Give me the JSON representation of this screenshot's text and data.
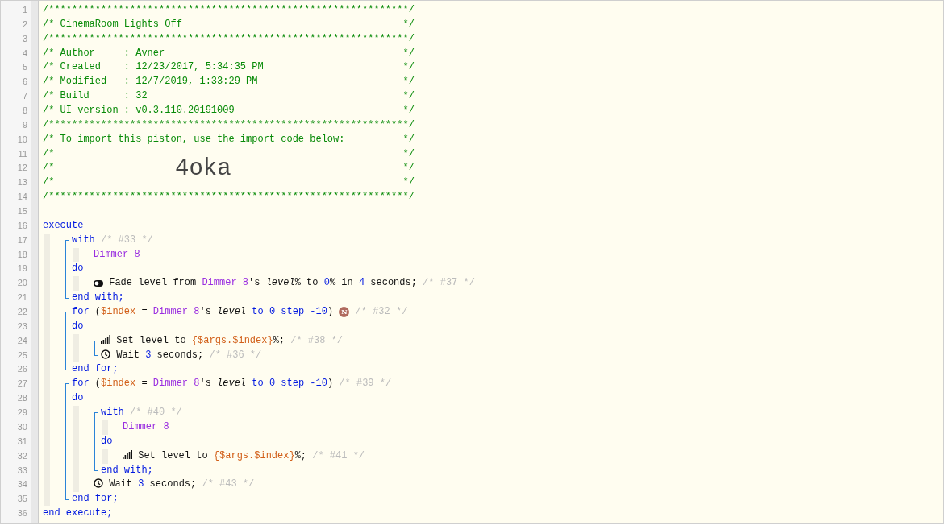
{
  "lines": [
    {
      "kind": "rule",
      "number": "1",
      "text": "/**************************************************************/"
    },
    {
      "kind": "box",
      "number": "2",
      "text": "/* CinemaRoom Lights Off",
      "end": "*/"
    },
    {
      "kind": "rule",
      "number": "3",
      "text": "/**************************************************************/"
    },
    {
      "kind": "box",
      "number": "4",
      "text": "/* Author     : Avner",
      "end": "*/"
    },
    {
      "kind": "box",
      "number": "5",
      "text": "/* Created    : 12/23/2017, 5:34:35 PM",
      "end": "*/"
    },
    {
      "kind": "box",
      "number": "6",
      "text": "/* Modified   : 12/7/2019, 1:33:29 PM",
      "end": "*/"
    },
    {
      "kind": "box",
      "number": "7",
      "text": "/* Build      : 32",
      "end": "*/"
    },
    {
      "kind": "box",
      "number": "8",
      "text": "/* UI version : v0.3.110.20191009",
      "end": "*/"
    },
    {
      "kind": "rule",
      "number": "9",
      "text": "/**************************************************************/"
    },
    {
      "kind": "box",
      "number": "10",
      "text": "/* To import this piston, use the import code below:",
      "end": "*/"
    },
    {
      "kind": "box",
      "number": "11",
      "text": "/*",
      "end": "*/"
    },
    {
      "kind": "code",
      "number": "12",
      "text": "/*",
      "code": "4oka",
      "end": "*/"
    },
    {
      "kind": "box",
      "number": "13",
      "text": "/*",
      "end": "*/"
    },
    {
      "kind": "rule",
      "number": "14",
      "text": "/**************************************************************/"
    },
    {
      "kind": "line",
      "number": "15"
    },
    {
      "kind": "line",
      "number": "16",
      "tokens": [
        {
          "kind": "kw",
          "text": "execute"
        }
      ]
    },
    {
      "kind": "body",
      "children": [
        {
          "kind": "block",
          "children": [
            {
              "kind": "line",
              "number": "17",
              "tokens": [
                {
                  "kind": "kw",
                  "text": "with"
                },
                {
                  "kind": "note",
                  "text": " /* #33 */"
                }
              ]
            },
            {
              "kind": "body",
              "children": [
                {
                  "kind": "line",
                  "number": "18",
                  "tokens": [
                    {
                      "kind": "device",
                      "text": "Dimmer 8"
                    }
                  ]
                }
              ]
            },
            {
              "kind": "line",
              "number": "19",
              "tokens": [
                {
                  "kind": "kw",
                  "text": "do"
                }
              ]
            },
            {
              "kind": "body",
              "children": [
                {
                  "kind": "line",
                  "number": "20",
                  "tokens": [
                    {
                      "kind": "toggle"
                    },
                    {
                      "kind": "plain",
                      "text": " Fade level from "
                    },
                    {
                      "kind": "device",
                      "text": "Dimmer 8"
                    },
                    {
                      "kind": "plain",
                      "text": "'s "
                    },
                    {
                      "kind": "italic",
                      "text": "level"
                    },
                    {
                      "kind": "plain",
                      "text": "% to "
                    },
                    {
                      "kind": "num",
                      "text": "0"
                    },
                    {
                      "kind": "plain",
                      "text": "% in "
                    },
                    {
                      "kind": "num",
                      "text": "4"
                    },
                    {
                      "kind": "plain",
                      "text": " seconds;"
                    },
                    {
                      "kind": "note",
                      "text": " /* #37 */"
                    }
                  ]
                }
              ]
            },
            {
              "kind": "line",
              "number": "21",
              "tokens": [
                {
                  "kind": "kw",
                  "text": "end with;"
                }
              ]
            }
          ]
        },
        {
          "kind": "block",
          "children": [
            {
              "kind": "line",
              "number": "22",
              "tokens": [
                {
                  "kind": "kw",
                  "text": "for"
                },
                {
                  "kind": "plain",
                  "text": " ("
                },
                {
                  "kind": "var",
                  "text": "$index"
                },
                {
                  "kind": "plain",
                  "text": " = "
                },
                {
                  "kind": "device",
                  "text": "Dimmer 8"
                },
                {
                  "kind": "plain",
                  "text": "'s "
                },
                {
                  "kind": "italic",
                  "text": "level"
                },
                {
                  "kind": "kw",
                  "text": " to "
                },
                {
                  "kind": "num",
                  "text": "0"
                },
                {
                  "kind": "kw",
                  "text": " step "
                },
                {
                  "kind": "num",
                  "text": "-10"
                },
                {
                  "kind": "plain",
                  "text": ") "
                },
                {
                  "kind": "badge",
                  "text": "N"
                },
                {
                  "kind": "note",
                  "text": " /* #32 */"
                }
              ]
            },
            {
              "kind": "line",
              "number": "23",
              "tokens": [
                {
                  "kind": "kw",
                  "text": "do"
                }
              ]
            },
            {
              "kind": "body",
              "children": [
                {
                  "kind": "block",
                  "children": [
                    {
                      "kind": "line",
                      "number": "24",
                      "tokens": [
                        {
                          "kind": "signal"
                        },
                        {
                          "kind": "plain",
                          "text": " Set level to "
                        },
                        {
                          "kind": "var",
                          "text": "{$args.$index}"
                        },
                        {
                          "kind": "plain",
                          "text": "%;"
                        },
                        {
                          "kind": "note",
                          "text": " /* #38 */"
                        }
                      ]
                    },
                    {
                      "kind": "line",
                      "number": "25",
                      "tokens": [
                        {
                          "kind": "clock"
                        },
                        {
                          "kind": "plain",
                          "text": " Wait "
                        },
                        {
                          "kind": "num",
                          "text": "3"
                        },
                        {
                          "kind": "plain",
                          "text": " seconds;"
                        },
                        {
                          "kind": "note",
                          "text": " /* #36 */"
                        }
                      ]
                    }
                  ]
                }
              ]
            },
            {
              "kind": "line",
              "number": "26",
              "tokens": [
                {
                  "kind": "kw",
                  "text": "end for;"
                }
              ]
            }
          ]
        },
        {
          "kind": "block",
          "children": [
            {
              "kind": "line",
              "number": "27",
              "tokens": [
                {
                  "kind": "kw",
                  "text": "for"
                },
                {
                  "kind": "plain",
                  "text": " ("
                },
                {
                  "kind": "var",
                  "text": "$index"
                },
                {
                  "kind": "plain",
                  "text": " = "
                },
                {
                  "kind": "device",
                  "text": "Dimmer 8"
                },
                {
                  "kind": "plain",
                  "text": "'s "
                },
                {
                  "kind": "italic",
                  "text": "level"
                },
                {
                  "kind": "kw",
                  "text": " to "
                },
                {
                  "kind": "num",
                  "text": "0"
                },
                {
                  "kind": "kw",
                  "text": " step "
                },
                {
                  "kind": "num",
                  "text": "-10"
                },
                {
                  "kind": "plain",
                  "text": ")"
                },
                {
                  "kind": "note",
                  "text": " /* #39 */"
                }
              ]
            },
            {
              "kind": "line",
              "number": "28",
              "tokens": [
                {
                  "kind": "kw",
                  "text": "do"
                }
              ]
            },
            {
              "kind": "body",
              "children": [
                {
                  "kind": "block",
                  "children": [
                    {
                      "kind": "line",
                      "number": "29",
                      "tokens": [
                        {
                          "kind": "kw",
                          "text": "with"
                        },
                        {
                          "kind": "note",
                          "text": " /* #40 */"
                        }
                      ]
                    },
                    {
                      "kind": "body",
                      "children": [
                        {
                          "kind": "line",
                          "number": "30",
                          "tokens": [
                            {
                              "kind": "device",
                              "text": "Dimmer 8"
                            }
                          ]
                        }
                      ]
                    },
                    {
                      "kind": "line",
                      "number": "31",
                      "tokens": [
                        {
                          "kind": "kw",
                          "text": "do"
                        }
                      ]
                    },
                    {
                      "kind": "body",
                      "children": [
                        {
                          "kind": "line",
                          "number": "32",
                          "tokens": [
                            {
                              "kind": "signal"
                            },
                            {
                              "kind": "plain",
                              "text": " Set level to "
                            },
                            {
                              "kind": "var",
                              "text": "{$args.$index}"
                            },
                            {
                              "kind": "plain",
                              "text": "%;"
                            },
                            {
                              "kind": "note",
                              "text": " /* #41 */"
                            }
                          ]
                        }
                      ]
                    },
                    {
                      "kind": "line",
                      "number": "33",
                      "tokens": [
                        {
                          "kind": "kw",
                          "text": "end with;"
                        }
                      ]
                    }
                  ]
                },
                {
                  "kind": "line",
                  "number": "34",
                  "tokens": [
                    {
                      "kind": "clock"
                    },
                    {
                      "kind": "plain",
                      "text": " Wait "
                    },
                    {
                      "kind": "num",
                      "text": "3"
                    },
                    {
                      "kind": "plain",
                      "text": " seconds;"
                    },
                    {
                      "kind": "note",
                      "text": " /* #43 */"
                    }
                  ]
                }
              ]
            },
            {
              "kind": "line",
              "number": "35",
              "tokens": [
                {
                  "kind": "kw",
                  "text": "end for;"
                }
              ]
            }
          ]
        }
      ]
    },
    {
      "kind": "line",
      "number": "36",
      "tokens": [
        {
          "kind": "kw",
          "text": "end execute;"
        }
      ]
    }
  ]
}
